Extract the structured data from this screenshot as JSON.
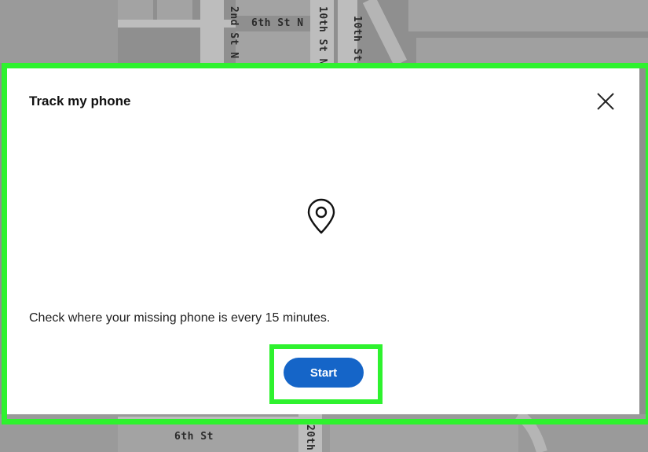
{
  "map": {
    "streets": {
      "top_6th_st_n": "6th St N",
      "top_2nd_st_n": "2nd St N",
      "top_10th_st_n": "10th St N",
      "top_10th_st": "10th St",
      "bottom_6th_st": "6th St",
      "bottom_20th": "20th"
    }
  },
  "dialog": {
    "title": "Track my phone",
    "close_icon": "close-icon",
    "pin_icon": "location-pin-icon",
    "message": "Check where your missing phone is every 15 minutes.",
    "start_label": "Start"
  },
  "colors": {
    "highlight": "#2ef22e",
    "button": "#1565c8",
    "map_bg": "#8f8f8f"
  }
}
